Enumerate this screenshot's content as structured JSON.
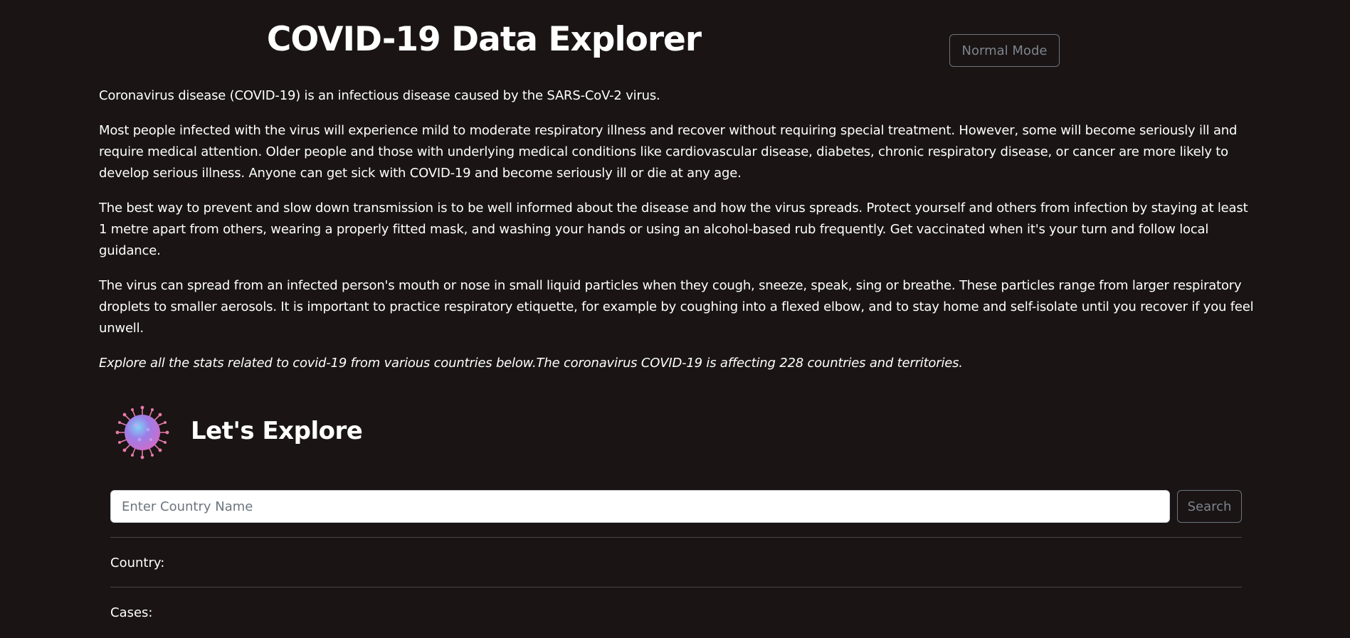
{
  "header": {
    "title": "COVID-19 Data Explorer",
    "mode_button_label": "Normal Mode"
  },
  "intro": {
    "paragraphs": [
      "Coronavirus disease (COVID-19) is an infectious disease caused by the SARS-CoV-2 virus.",
      "Most people infected with the virus will experience mild to moderate respiratory illness and recover without requiring special treatment. However, some will become seriously ill and require medical attention. Older people and those with underlying medical conditions like cardiovascular disease, diabetes, chronic respiratory disease, or cancer are more likely to develop serious illness. Anyone can get sick with COVID-19 and become seriously ill or die at any age.",
      "The best way to prevent and slow down transmission is to be well informed about the disease and how the virus spreads. Protect yourself and others from infection by staying at least 1 metre apart from others, wearing a properly fitted mask, and washing your hands or using an alcohol-based rub frequently. Get vaccinated when it's your turn and follow local guidance.",
      "The virus can spread from an infected person's mouth or nose in small liquid particles when they cough, sneeze, speak, sing or breathe. These particles range from larger respiratory droplets to smaller aerosols. It is important to practice respiratory etiquette, for example by coughing into a flexed elbow, and to stay home and self-isolate until you recover if you feel unwell."
    ],
    "note": "Explore all the stats related to covid-19 from various countries below.The coronavirus COVID-19 is affecting 228 countries and territories."
  },
  "explore": {
    "title": "Let's Explore",
    "icon": "virus-icon"
  },
  "search": {
    "placeholder": "Enter Country Name",
    "value": "",
    "button_label": "Search"
  },
  "stats": {
    "country_label": "Country:",
    "cases_label": "Cases:"
  },
  "colors": {
    "background": "#1a1415",
    "text": "#ffffff",
    "outline_button": "#6c757d"
  }
}
